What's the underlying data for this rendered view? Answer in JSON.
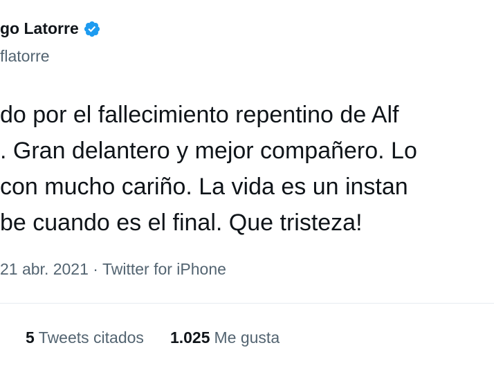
{
  "author": {
    "display_name": "go Latorre",
    "handle": "flatorre",
    "verified_icon": "verified-badge-icon",
    "verified_color": "#1d9bf0"
  },
  "tweet": {
    "lines": [
      "do por el fallecimiento repentino de Alf",
      ". Gran delantero y mejor compañero. Lo",
      "con mucho cariño. La vida es un instan",
      "be cuando es el final. Que tristeza!"
    ]
  },
  "meta": {
    "date": "21 abr. 2021",
    "separator": "·",
    "source": "Twitter for iPhone"
  },
  "stats": {
    "quotes_count": "5",
    "quotes_label": "Tweets citados",
    "likes_count": "1.025",
    "likes_label": "Me gusta"
  }
}
